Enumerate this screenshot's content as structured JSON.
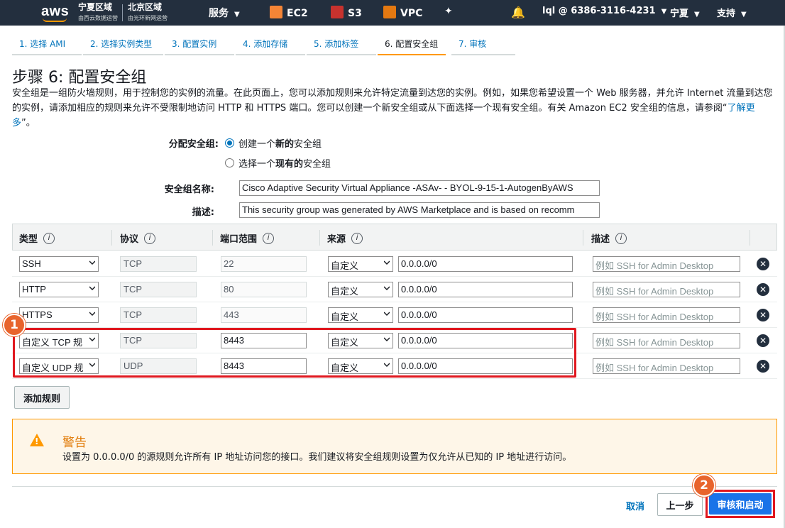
{
  "topnav": {
    "logo": "aws",
    "region1_title": "宁夏区域",
    "region1_sub": "由西云数据运营",
    "region2_title": "北京区域",
    "region2_sub": "由光环新网运营",
    "services": "服务",
    "ec2": "EC2",
    "s3": "S3",
    "vpc": "VPC",
    "account": "lql @ 6386-3116-4231",
    "region": "宁夏",
    "support": "支持",
    "icons": [
      "pin-icon",
      "bell-icon"
    ]
  },
  "tabs": [
    {
      "label": "1. 选择 AMI"
    },
    {
      "label": "2. 选择实例类型"
    },
    {
      "label": "3. 配置实例"
    },
    {
      "label": "4. 添加存储"
    },
    {
      "label": "5. 添加标签"
    },
    {
      "label": "6. 配置安全组"
    },
    {
      "label": "7. 审核"
    }
  ],
  "page": {
    "title": "步骤 6: 配置安全组",
    "intro": "安全组是一组防火墙规则，用于控制您的实例的流量。在此页面上，您可以添加规则来允许特定流量到达您的实例。例如，如果您希望设置一个 Web 服务器，并允许 Internet 流量到达您的实例，请添加相应的规则来允许不受限制地访问 HTTP 和 HTTPS 端口。您可以创建一个新安全组或从下面选择一个现有安全组。有关 Amazon EC2 安全组的信息，请参阅",
    "learn_more": "了解更多",
    "intro_end": "。"
  },
  "form": {
    "assign_label": "分配安全组:",
    "opt_new_pre": "创建一个",
    "opt_new_bold": "新的",
    "opt_new_post": "安全组",
    "opt_existing_pre": "选择一个",
    "opt_existing_bold": "现有的",
    "opt_existing_post": "安全组",
    "name_label": "安全组名称:",
    "name_value": "Cisco Adaptive Security Virtual Appliance -ASAv- - BYOL-9-15-1-AutogenByAWS",
    "desc_label": "描述:",
    "desc_value": "This security group was generated by AWS Marketplace and is based on recomm"
  },
  "table": {
    "headers": [
      "类型",
      "协议",
      "端口范围",
      "来源",
      "描述"
    ],
    "info_icon": "i",
    "desc_placeholder": "例如 SSH for Admin Desktop",
    "rows": [
      {
        "type": "SSH",
        "protocol": "TCP",
        "port": "22",
        "source": "自定义",
        "cidr": "0.0.0.0/0",
        "port_editable": false
      },
      {
        "type": "HTTP",
        "protocol": "TCP",
        "port": "80",
        "source": "自定义",
        "cidr": "0.0.0.0/0",
        "port_editable": false
      },
      {
        "type": "HTTPS",
        "protocol": "TCP",
        "port": "443",
        "source": "自定义",
        "cidr": "0.0.0.0/0",
        "port_editable": false
      },
      {
        "type": "自定义 TCP 规",
        "protocol": "TCP",
        "port": "8443",
        "source": "自定义",
        "cidr": "0.0.0.0/0",
        "port_editable": true
      },
      {
        "type": "自定义 UDP 规",
        "protocol": "UDP",
        "port": "8443",
        "source": "自定义",
        "cidr": "0.0.0.0/0",
        "port_editable": true
      }
    ]
  },
  "add_rule": "添加规则",
  "warning": {
    "title": "警告",
    "text": "设置为 0.0.0.0/0 的源规则允许所有 IP 地址访问您的接口。我们建议将安全组规则设置为仅允许从已知的 IP 地址进行访问。"
  },
  "footer": {
    "cancel": "取消",
    "previous": "上一步",
    "review_launch": "审核和启动"
  },
  "badges": [
    "1",
    "2"
  ],
  "colors": {
    "nav_bg": "#232f3e",
    "accent_orange": "#ff9900",
    "link_blue": "#0073bb",
    "highlight_red": "#e0181f",
    "badge_orange": "#e8642d",
    "primary_blue": "#1a73e8"
  }
}
